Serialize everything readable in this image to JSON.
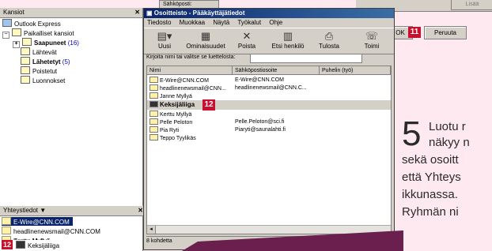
{
  "bg_dialog": {
    "field_label": "Sähköposti:",
    "add_label": "Lisää",
    "ok_label": "OK",
    "cancel_label": "Peruuta",
    "ok_badge": "11"
  },
  "folders": {
    "header": "Kansiot",
    "items": [
      {
        "label": "Outlook Express"
      },
      {
        "label": "Paikalliset kansiot"
      },
      {
        "label": "Saapuneet",
        "count": "(16)"
      },
      {
        "label": "Lähtevät"
      },
      {
        "label": "Lähetetyt",
        "count": "(5)"
      },
      {
        "label": "Poistetut"
      },
      {
        "label": "Luonnokset"
      }
    ]
  },
  "contacts": {
    "header": "Yhteystiedot ▼",
    "items": [
      "E-Wire@CNN.COM",
      "headlinenewsmail@CNN.COM",
      "Janne Myllyä",
      "Kerttu Myllyä",
      "Pelle Peloton",
      "Pia Ryti",
      "Teppo Tyylikäs",
      "Keksijäliiga"
    ],
    "badge": "12"
  },
  "window": {
    "title": "Osoitteisto - Pääkäyttäjätiedot",
    "menu": [
      "Tiedosto",
      "Muokkaa",
      "Näytä",
      "Työkalut",
      "Ohje"
    ],
    "toolbar": [
      {
        "label": "Uusi",
        "icon": "new-contact-icon"
      },
      {
        "label": "Ominaisuudet",
        "icon": "properties-icon"
      },
      {
        "label": "Poista",
        "icon": "delete-icon"
      },
      {
        "label": "Etsi henkilö",
        "icon": "find-people-icon"
      },
      {
        "label": "Tulosta",
        "icon": "print-icon"
      },
      {
        "label": "Toimi",
        "icon": "action-icon"
      }
    ],
    "find_label": "Kirjoita nimi tai valitse se luettelosta:",
    "find_value": "",
    "columns": [
      "Nimi",
      "Sähköpostiosoite",
      "Puhelin (työ)"
    ],
    "rows": [
      {
        "name": "E-Wire@CNN.COM",
        "email": "E-Wire@CNN.COM"
      },
      {
        "name": "headlinenewsmail@CNN...",
        "email": "headlinenewsmail@CNN.C..."
      },
      {
        "name": "Janne Myllyä",
        "email": ""
      },
      {
        "name": "Keksijäliiga",
        "email": "",
        "selected": true,
        "badge": "12"
      },
      {
        "name": "Kerttu Myllyä",
        "email": ""
      },
      {
        "name": "Pelle Peloton",
        "email": "Pelle.Peloton@sci.fi"
      },
      {
        "name": "Pia Ryti",
        "email": "Piaryti@saunalahti.fi"
      },
      {
        "name": "Teppo Tyylikäs",
        "email": ""
      }
    ],
    "status": "8 kohdetta"
  },
  "side_text": {
    "step": "5",
    "lines": [
      "Luotu r",
      "näkyy n",
      "sekä osoitt",
      "että Yhteys",
      "ikkunassa.",
      "Ryhmän ni"
    ]
  },
  "colors": {
    "accent": "#c8102e",
    "titlebar": "#0a246a",
    "swoosh": "#6b1f4f"
  }
}
